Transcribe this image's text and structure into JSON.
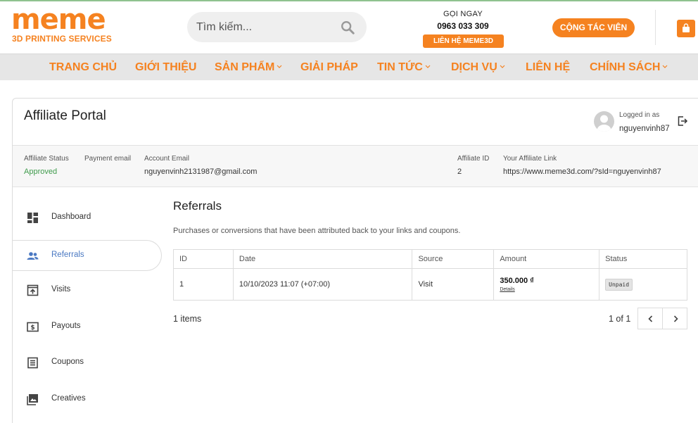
{
  "header": {
    "logo_word": "meme",
    "logo_sub": "3D PRINTING SERVICES",
    "search_placeholder": "Tìm kiếm...",
    "hotline_label": "GỌI NGAY",
    "hotline_phone": "0963 033 309",
    "contact_button": "LIÊN HỆ MEME3D",
    "ctv_button": "CỘNG TÁC VIÊN"
  },
  "nav": {
    "items": [
      {
        "label": "TRANG CHỦ",
        "has_dropdown": false
      },
      {
        "label": "GIỚI THIỆU",
        "has_dropdown": false
      },
      {
        "label": "SẢN PHẨM",
        "has_dropdown": true
      },
      {
        "label": "GIẢI PHÁP",
        "has_dropdown": false
      },
      {
        "label": "TIN TỨC",
        "has_dropdown": true
      },
      {
        "label": "DỊCH VỤ",
        "has_dropdown": true
      },
      {
        "label": "LIÊN HỆ",
        "has_dropdown": false
      },
      {
        "label": "CHÍNH SÁCH",
        "has_dropdown": true
      }
    ]
  },
  "portal": {
    "title": "Affiliate Portal",
    "logged_in_label": "Logged in as",
    "username": "nguyenvinh87"
  },
  "info": {
    "status_label": "Affiliate Status",
    "status_value": "Approved",
    "payment_email_label": "Payment email",
    "account_email_label": "Account Email",
    "account_email_value": "nguyenvinh2131987@gmail.com",
    "affiliate_id_label": "Affiliate ID",
    "affiliate_id_value": "2",
    "link_label": "Your Affiliate Link",
    "link_value": "https://www.meme3d.com/?sId=nguyenvinh87"
  },
  "sidebar": {
    "items": [
      {
        "label": "Dashboard",
        "icon": "dashboard-icon"
      },
      {
        "label": "Referrals",
        "icon": "people-icon"
      },
      {
        "label": "Visits",
        "icon": "visits-icon"
      },
      {
        "label": "Payouts",
        "icon": "payouts-icon"
      },
      {
        "label": "Coupons",
        "icon": "coupons-icon"
      },
      {
        "label": "Creatives",
        "icon": "image-icon"
      }
    ],
    "active_index": 1
  },
  "referrals": {
    "title": "Referrals",
    "description": "Purchases or conversions that have been attributed back to your links and coupons.",
    "columns": [
      "ID",
      "Date",
      "Source",
      "Amount",
      "Status"
    ],
    "rows": [
      {
        "id": "1",
        "date": "10/10/2023 11:07 (+07:00)",
        "source": "Visit",
        "amount": "350.000 ₫",
        "details": "Details",
        "status": "Unpaid"
      }
    ],
    "items_count": "1 items",
    "page_info": "1 of 1"
  },
  "colors": {
    "brand": "#f58220",
    "approved": "#3f9b4c",
    "active_link": "#4a78c2"
  }
}
